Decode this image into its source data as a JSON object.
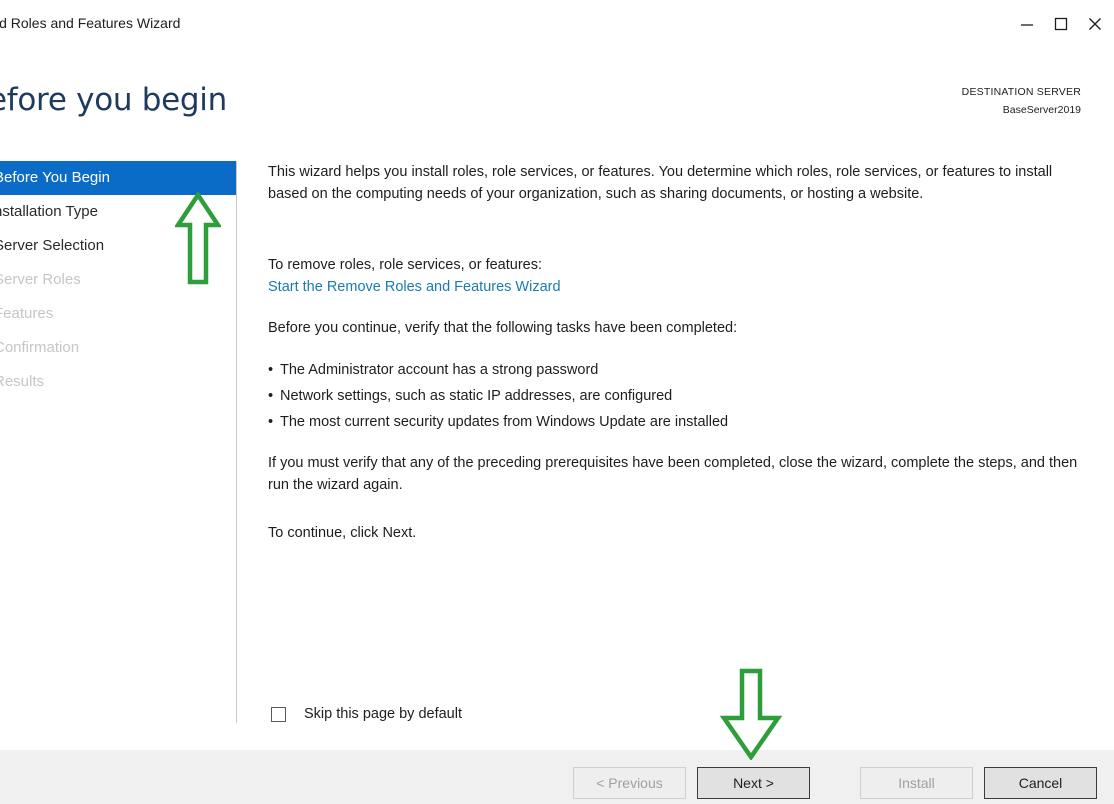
{
  "window": {
    "title": "ld Roles and Features Wizard",
    "controls": {
      "minimize": "minimize-icon",
      "maximize": "maximize-icon",
      "close": "close-icon"
    }
  },
  "header": {
    "heading": "efore you begin",
    "destination_label": "DESTINATION SERVER",
    "destination_server": "BaseServer2019"
  },
  "nav": {
    "items": [
      {
        "label": "Before You Begin",
        "state": "active"
      },
      {
        "label": "nstallation Type",
        "state": "enabled"
      },
      {
        "label": "Server Selection",
        "state": "enabled"
      },
      {
        "label": "Server Roles",
        "state": "disabled"
      },
      {
        "label": "Features",
        "state": "disabled"
      },
      {
        "label": "Confirmation",
        "state": "disabled"
      },
      {
        "label": "Results",
        "state": "disabled"
      }
    ]
  },
  "content": {
    "intro": "This wizard helps you install roles, role services, or features. You determine which roles, role services, or features to install based on the computing needs of your organization, such as sharing documents, or hosting a website.",
    "remove_prompt": "To remove roles, role services, or features:",
    "remove_link": "Start the Remove Roles and Features Wizard",
    "verify_prompt": "Before you continue, verify that the following tasks have been completed:",
    "bullet_char": "•",
    "bullets": [
      "The Administrator account has a strong password",
      "Network settings, such as static IP addresses, are configured",
      "The most current security updates from Windows Update are installed"
    ],
    "prereq_note": "If you must verify that any of the preceding prerequisites have been completed, close the wizard, complete the steps, and then run the wizard again.",
    "continue_note": "To continue, click Next."
  },
  "skip": {
    "label": "Skip this page by default",
    "checked": false
  },
  "footer": {
    "previous": "< Previous",
    "next": "Next >",
    "install": "Install",
    "cancel": "Cancel"
  },
  "colors": {
    "active_nav": "#0b6cc7",
    "link": "#1a7bb0",
    "heading": "#1e3a5c",
    "annotation_arrow": "#2e9e3a",
    "footer_bg": "#f0f0f0"
  }
}
